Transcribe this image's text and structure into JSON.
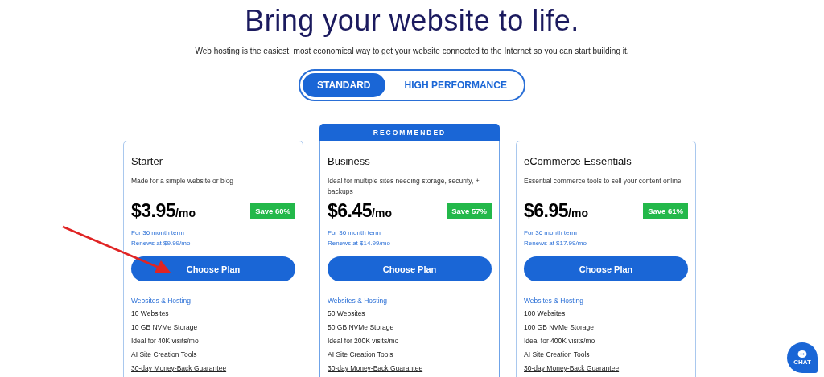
{
  "title": "Bring your website to life.",
  "subtitle": "Web hosting is the easiest, most economical way to get your website connected to the Internet so you can start building it.",
  "tabs": [
    {
      "label": "STANDARD",
      "selected": true
    },
    {
      "label": "HIGH PERFORMANCE",
      "selected": false
    }
  ],
  "plans": [
    {
      "name": "Starter",
      "description": "Made for a simple website or blog",
      "price": "$3.95",
      "unit": "/mo",
      "save": "Save 60%",
      "term": "For 36 month term",
      "renews": "Renews at $9.99/mo",
      "button": "Choose Plan",
      "section": "Websites & Hosting",
      "features": [
        {
          "text": "10 Websites",
          "kind": "plain"
        },
        {
          "text": "10 GB NVMe Storage",
          "kind": "plain"
        },
        {
          "text": "Ideal for 40K visits/mo",
          "kind": "plain"
        },
        {
          "text": "AI Site Creation Tools",
          "kind": "plain"
        },
        {
          "text": "30-day Money-Back Guarantee",
          "kind": "link"
        }
      ]
    },
    {
      "name": "Business",
      "badge": "RECOMMENDED",
      "description": "Ideal for multiple sites needing storage, security, + backups",
      "price": "$6.45",
      "unit": "/mo",
      "save": "Save 57%",
      "term": "For 36 month term",
      "renews": "Renews at $14.99/mo",
      "button": "Choose Plan",
      "section": "Websites & Hosting",
      "features": [
        {
          "text": "50 Websites",
          "kind": "plain"
        },
        {
          "text": "50 GB NVMe Storage",
          "kind": "plain"
        },
        {
          "text": "Ideal for 200K visits/mo",
          "kind": "plain"
        },
        {
          "text": "AI Site Creation Tools",
          "kind": "plain"
        },
        {
          "text": "30-day Money-Back Guarantee",
          "kind": "link"
        }
      ]
    },
    {
      "name": "eCommerce Essentials",
      "description": "Essential commerce tools to sell your content online",
      "price": "$6.95",
      "unit": "/mo",
      "save": "Save 61%",
      "term": "For 36 month term",
      "renews": "Renews at $17.99/mo",
      "button": "Choose Plan",
      "section": "Websites & Hosting",
      "features": [
        {
          "text": "100 Websites",
          "kind": "plain"
        },
        {
          "text": "100 GB NVMe Storage",
          "kind": "plain"
        },
        {
          "text": "Ideal for 400K visits/mo",
          "kind": "plain"
        },
        {
          "text": "AI Site Creation Tools",
          "kind": "plain"
        },
        {
          "text": "30-day Money-Back Guarantee",
          "kind": "link"
        }
      ]
    }
  ],
  "chat": {
    "label": "CHAT"
  }
}
